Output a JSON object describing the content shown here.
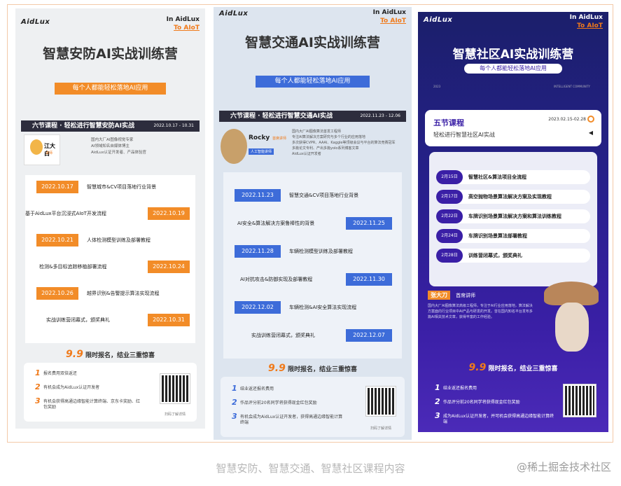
{
  "posters": {
    "security": {
      "logo": "AidLux",
      "slogan_top": "In AidLux",
      "slogan_bottom": "To AIoT",
      "title": "智慧安防AI实战训练营",
      "banner": "每个人都能轻松落地AI应用",
      "section_title": "六节课程 · 轻松进行智慧安防AI实战",
      "section_date": "2022.10.17 - 10.31",
      "lecturer_name": "江大白",
      "lecturer_tag": "讲师",
      "lecturer_bio": [
        "国内大厂AI图像视觉专家",
        "AI领域知名自媒体博主",
        "AidLux认证开发者、产品体验官"
      ],
      "schedule": [
        {
          "date": "2022.10.17",
          "topic": "智慧城市&CV项目落地行业背景",
          "side": "left"
        },
        {
          "date": "2022.10.19",
          "topic": "基于AidLux平台沉浸式AIoT开发流程",
          "side": "right"
        },
        {
          "date": "2022.10.21",
          "topic": "人体检测模型训练及部署教程",
          "side": "left"
        },
        {
          "date": "2022.10.24",
          "topic": "检测&多目标追踪移植部署流程",
          "side": "right"
        },
        {
          "date": "2022.10.26",
          "topic": "越界识别&告警提示算法实现流程",
          "side": "left"
        },
        {
          "date": "2022.10.31",
          "topic": "实战训练营闭幕式，颁奖典礼",
          "side": "right"
        }
      ],
      "promo_big": "9.9",
      "promo_text": "限时报名，结业三重惊喜",
      "benefits": [
        "报名费用双倍返还",
        "有机会成为AidLux认证开发者",
        "有机会获得高通边缘智能计算终端、京东卡奖励、红包奖励"
      ],
      "qr_caption": "扫码了解详情"
    },
    "traffic": {
      "logo": "AidLux",
      "slogan_top": "In AidLux",
      "slogan_bottom": "To AIoT",
      "title": "智慧交通AI实战训练营",
      "banner": "每个人都能轻松落地AI应用",
      "section_title": "六节课程 · 轻松进行智慧交通AI实战",
      "section_date": "2022.11.23 - 12.06",
      "lecturer_name": "Rocky",
      "lecturer_tag": "首席讲师",
      "lecturer_badge": "人工智能讲师",
      "lecturer_bio": [
        "国内大厂AI图像算法首发工程师",
        "专注AI算法解决方案研究与多个行业的应用落地",
        "多次获得CVPR、AAAI、Kaggle等顶级会议与平台的算法竞赛冠军",
        "多篇论文专利、产出多篇yolo系列博客文章",
        "AidLux认证开发者"
      ],
      "schedule": [
        {
          "date": "2022.11.23",
          "topic": "智慧交通&CV项目落地行业背景",
          "side": "left"
        },
        {
          "date": "2022.11.25",
          "topic": "AI安全&算法解决方案鲁棒性的背景",
          "side": "right"
        },
        {
          "date": "2022.11.28",
          "topic": "车辆检测模型训练及部署教程",
          "side": "left"
        },
        {
          "date": "2022.11.30",
          "topic": "AI对抗攻击&防御实现及部署教程",
          "side": "right"
        },
        {
          "date": "2022.12.02",
          "topic": "车辆检测&AI安全算法实现流程",
          "side": "left"
        },
        {
          "date": "2022.12.07",
          "topic": "实战训练营闭幕式，颁奖典礼",
          "side": "right"
        }
      ],
      "promo_big": "9.9",
      "promo_text": "限时报名，结业三重惊喜",
      "benefits": [
        "结业返还报名费用",
        "作品评分前20名同学将获得现金红包奖励",
        "有机会成为AidLux认证开发者，获得高通边缘智能计算终端"
      ],
      "qr_caption": "扫码了解详情"
    },
    "community": {
      "logo": "AidLux",
      "slogan_top": "In AidLux",
      "slogan_bottom": "To AIoT",
      "title": "智慧社区AI实战训练营",
      "banner": "每个人都能轻松落地AI应用",
      "sub_left": "2023",
      "sub_right": "INTELLIGENT COMMUNITY",
      "card_title": "五节课程",
      "card_date": "2023.02.15-02.28",
      "card_subtitle": "轻松进行智慧社区AI实战",
      "schedule": [
        {
          "date": "2月15日",
          "topic": "智慧社区&算法项目全流程"
        },
        {
          "date": "2月17日",
          "topic": "高空抛物场景算法解决方案及实现教程"
        },
        {
          "date": "2月22日",
          "topic": "车牌识别场景算法解决方案和算法训练教程"
        },
        {
          "date": "2月24日",
          "topic": "车牌识别场景算法部署教程"
        },
        {
          "date": "2月28日",
          "topic": "训练营闭幕式，颁奖典礼"
        }
      ],
      "lecturer_name": "张大刀",
      "lecturer_tag": "首席讲师",
      "lecturer_bio": "国内大厂AI图像算法高级工程师，专注于AI行业应用落地，算法解决方案面向行业项目中AI产品与研发的开发。曾在国内知名平台发布多篇AI相关技术文章，获得丰富的工作经验。",
      "promo_big": "9.9",
      "promo_text": "限时报名，结业三重惊喜",
      "benefits": [
        "结业返还报名费用",
        "作品评分前20名同学将获得现金红包奖励",
        "成为AidLux认证开发者，并可机会获得高通边缘智能计算终端"
      ]
    }
  },
  "caption": "智慧安防、智慧交通、智慧社区课程内容",
  "watermark": "@稀土掘金技术社区",
  "colors": {
    "orange": "#f28c28",
    "blue": "#3d6cd9",
    "dark": "#2d2d3d",
    "purple": "#3a1fa6"
  }
}
